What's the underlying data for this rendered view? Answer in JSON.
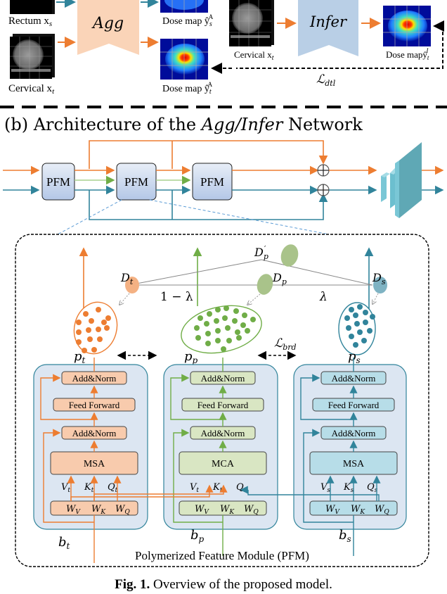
{
  "top": {
    "agg": {
      "label": "Agg",
      "input_source": "Rectum x",
      "input_source_sub": "s",
      "input_target": "Cervical x",
      "input_target_sub": "t",
      "output_source": "Dose map ŷ",
      "output_source_sub": "s",
      "output_source_sup": "A",
      "output_target": "Dose map ŷ",
      "output_target_sub": "t",
      "output_target_sup": "A"
    },
    "infer": {
      "label": "Infer",
      "input": "Cervical x",
      "input_sub": "t",
      "output": "Dose mapŷ",
      "output_sub": "t",
      "output_sup": "I"
    },
    "loss_dtl": "ℒ",
    "loss_dtl_sub": "dtl"
  },
  "section_b": {
    "title_prefix": "(b) Architecture of the ",
    "title_math": "Agg/Infer",
    "title_suffix": " Network",
    "pfm_blocks": [
      "PFM",
      "PFM",
      "PFM"
    ],
    "sum_symbol": "⊕"
  },
  "pfm_detail": {
    "domains": {
      "Dt": "D",
      "Dt_sub": "t",
      "Dp": "D",
      "Dp_sub": "p",
      "Dp_prime": "D",
      "Dp_prime_sub": "p",
      "Dp_prime_sup": "′",
      "Ds": "D",
      "Ds_sub": "s"
    },
    "weights": {
      "left": "1 − λ",
      "right": "λ"
    },
    "loss_brd": "ℒ",
    "loss_brd_sub": "brd",
    "prototypes": {
      "pt": "p",
      "pt_sub": "t",
      "pp": "p",
      "pp_sub": "p",
      "ps": "p",
      "ps_sub": "s"
    },
    "branches": [
      {
        "id": "target",
        "color": "#ED7D31",
        "fill": "#F8CBAD",
        "input": "b",
        "input_sub": "t",
        "attn": "MSA",
        "add_norm": "Add&Norm",
        "ffn": "Feed Forward",
        "qkv": [
          "V",
          "K",
          "Q"
        ],
        "qkv_sub": [
          "t",
          "t",
          "t"
        ],
        "w": [
          "W",
          "W",
          "W"
        ],
        "w_sub": [
          "V",
          "K",
          "Q"
        ]
      },
      {
        "id": "polymerized",
        "color": "#70AD47",
        "fill": "#D9E6C3",
        "input": "b",
        "input_sub": "p",
        "attn": "MCA",
        "add_norm": "Add&Norm",
        "ffn": "Feed Forward",
        "qkv": [
          "V",
          "K",
          "Q"
        ],
        "qkv_sub": [
          "t",
          "t",
          "s"
        ],
        "w": [
          "W",
          "W",
          "W"
        ],
        "w_sub": [
          "V",
          "K",
          "Q"
        ]
      },
      {
        "id": "source",
        "color": "#31849B",
        "fill": "#B7DDE8",
        "input": "b",
        "input_sub": "s",
        "attn": "MSA",
        "add_norm": "Add&Norm",
        "ffn": "Feed Forward",
        "qkv": [
          "V",
          "K",
          "Q"
        ],
        "qkv_sub": [
          "s",
          "s",
          "s"
        ],
        "w": [
          "W",
          "W",
          "W"
        ],
        "w_sub": [
          "V",
          "K",
          "Q"
        ]
      }
    ],
    "module_caption": "Polymerized Feature Module (PFM)"
  },
  "caption": {
    "bold": "Fig. 1.",
    "text": " Overview of the proposed model."
  },
  "colors": {
    "orange": "#ED7D31",
    "teal": "#31849B",
    "green": "#70AD47",
    "agg_fill": "#FAD4B8",
    "infer_fill": "#B9CFE6",
    "pfm_bg": "#DCE6F2"
  }
}
